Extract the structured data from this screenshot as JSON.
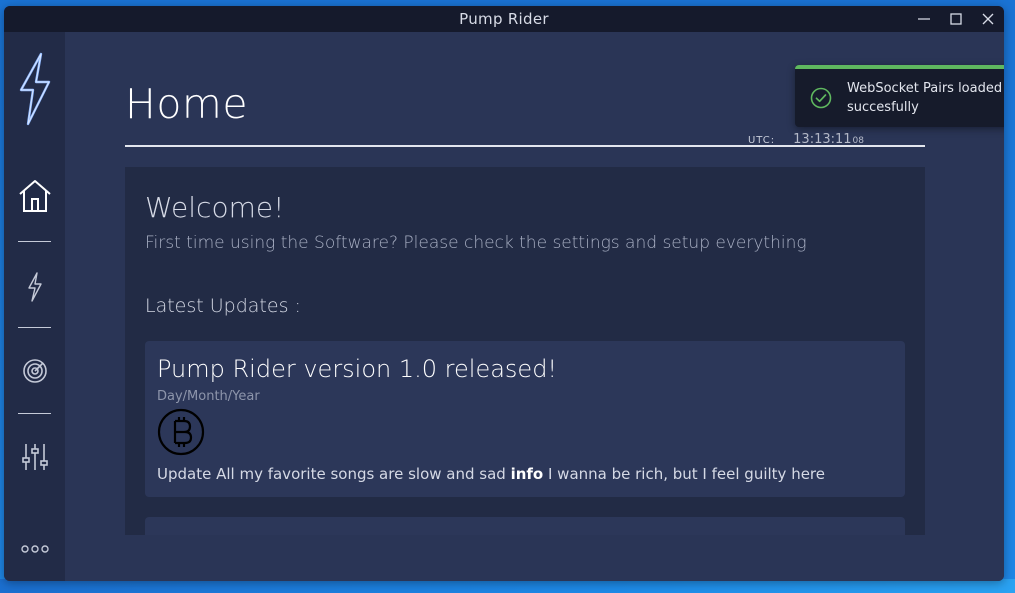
{
  "window": {
    "title": "Pump Rider"
  },
  "sidebar": {
    "items": [
      {
        "icon": "home-icon"
      },
      {
        "icon": "lightning-icon"
      },
      {
        "icon": "radar-icon"
      },
      {
        "icon": "sliders-icon"
      },
      {
        "icon": "more-icon"
      }
    ]
  },
  "header": {
    "title": "Home",
    "utc_label": "UTC:",
    "time": "13:13:11",
    "seconds_fraction": "08"
  },
  "main": {
    "welcome_title": "Welcome!",
    "welcome_subtitle": "First time using the Software? Please check the settings and setup everything",
    "updates_heading": "Latest Updates :",
    "updates": [
      {
        "title": "Pump Rider version 1.0 released!",
        "date": "Day/Month/Year",
        "icon": "bitcoin-icon",
        "body_prefix": "Update All my favorite songs are slow and sad ",
        "body_strong": "info",
        "body_suffix": " I wanna be rich, but I feel guilty here"
      }
    ]
  },
  "toast": {
    "message": "WebSocket Pairs loaded succesfully",
    "status_color": "#5fb85f"
  },
  "colors": {
    "titlebar": "#151a2c",
    "sidebar": "#222b47",
    "main_bg": "#2a3556",
    "panel_bg": "#222b45",
    "card_bg": "#2c3759",
    "logo_glow": "#8fb8ff"
  }
}
